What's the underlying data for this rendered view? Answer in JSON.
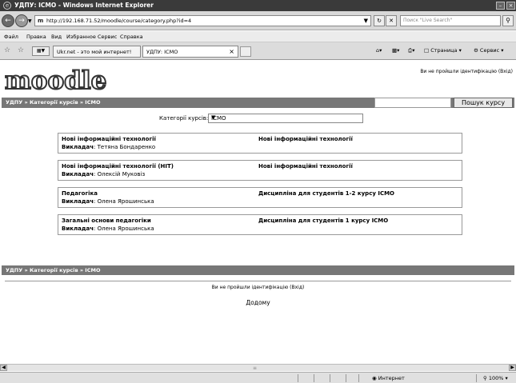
{
  "window": {
    "title": "УДПУ: ICMO - Windows Internet Explorer",
    "minimize": "–",
    "close": "×"
  },
  "address": {
    "url": "http://192.168.71.52/moodle/course/category.php?id=4",
    "favicon_text": "m",
    "search_placeholder": "Поиск \"Live Search\""
  },
  "menu": [
    "Файл",
    "Правка",
    "Вид",
    "Избранное",
    "Сервис",
    "Справка"
  ],
  "tabs": [
    {
      "label": "Ukr.net - это мой интернет!"
    },
    {
      "label": "УДПУ: ICMO"
    }
  ],
  "toolbar": {
    "page_label": "Страница",
    "tools_label": "Сервис"
  },
  "site": {
    "logo": "moodle",
    "login_status": "Ви не пройшли ідентифікацію (Вхід)"
  },
  "breadcrumb": "УДПУ » Категорії курсів » ICMO",
  "search_courses_button": "Пошук курсу",
  "category": {
    "label": "Категорії курсів:",
    "selected": "ICMO"
  },
  "courses": [
    {
      "name": "Нові інформаційні технології",
      "teacher_label": "Викладач",
      "teacher": "Тетяна Бондаренко",
      "summary": "Нові інформаційні технології"
    },
    {
      "name": "Нові інформаційні технології (НІТ)",
      "teacher_label": "Викладач",
      "teacher": "Олексій Муковіз",
      "summary": "Нові інформаційні технології"
    },
    {
      "name": "Педагогіка",
      "teacher_label": "Викладач",
      "teacher": "Олена Ярошинська",
      "summary": "Дисципліна для студентів 1-2 курсу ICMO"
    },
    {
      "name": "Загальні основи педагогіки",
      "teacher_label": "Викладач",
      "teacher": "Олена Ярошинська",
      "summary": "Дисципліна для студентів 1 курсу ICMO"
    }
  ],
  "footer": {
    "login_status": "Ви не пройшли ідентифікацію (Вхід)",
    "home_link": "Додому"
  },
  "status": {
    "zone": "Интернет",
    "zoom": "100%"
  }
}
